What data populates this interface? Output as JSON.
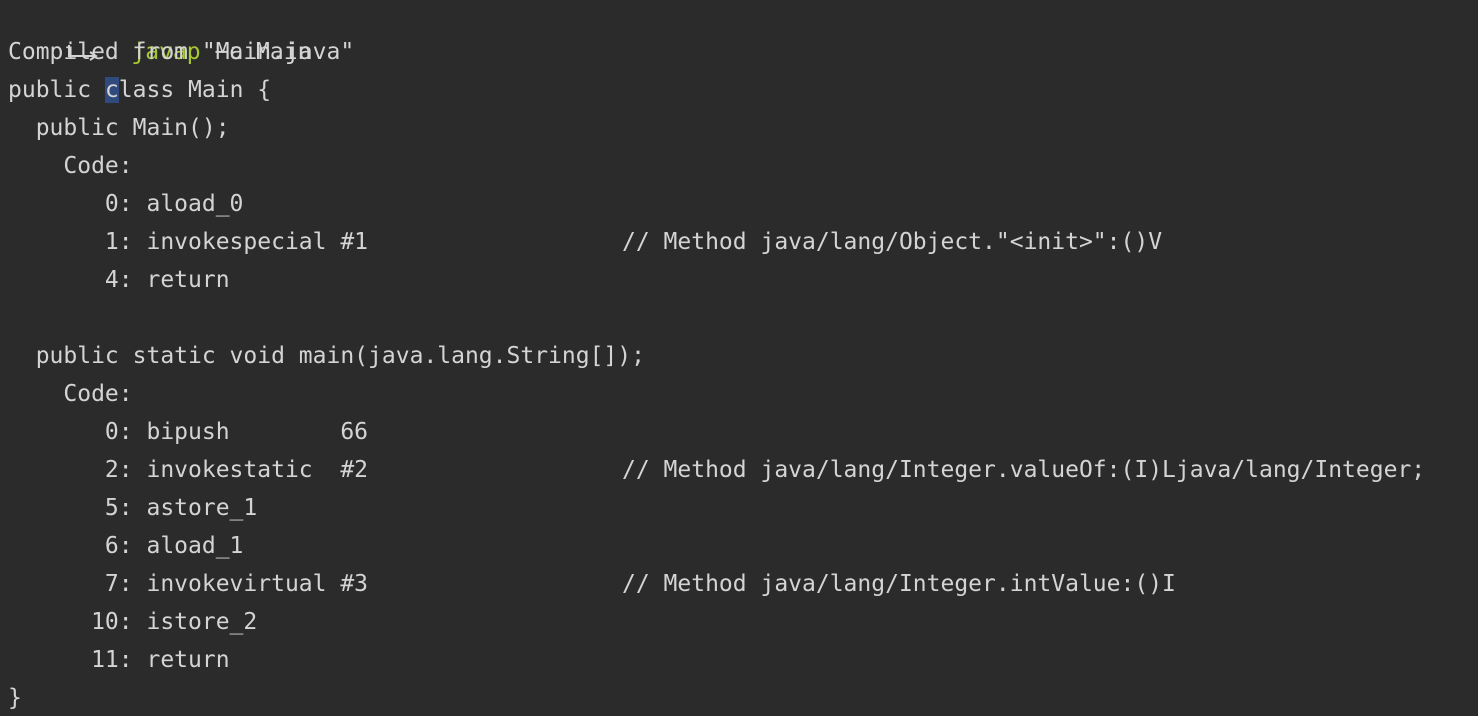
{
  "prompt": {
    "command": "javap",
    "args": " −c Main"
  },
  "output": {
    "compiled_from": "Compiled from \"Main.java\"",
    "class_decl_pre": "public ",
    "class_decl_cursor": "c",
    "class_decl_post": "lass Main {",
    "ctor_sig": "  public Main();",
    "ctor_code_label": "    Code:",
    "ctor_instr_0": "       0: aload_0",
    "ctor_instr_1": "       1: invokespecial #1",
    "ctor_comment_1": "// Method java/lang/Object.\"<init>\":()V",
    "ctor_instr_4": "       4: return",
    "main_sig": "  public static void main(java.lang.String[]);",
    "main_code_label": "    Code:",
    "main_instr_0": "       0: bipush        66",
    "main_instr_2": "       2: invokestatic  #2",
    "main_comment_2": "// Method java/lang/Integer.valueOf:(I)Ljava/lang/Integer;",
    "main_instr_5": "       5: astore_1",
    "main_instr_6": "       6: aload_1",
    "main_instr_7": "       7: invokevirtual #3",
    "main_comment_7": "// Method java/lang/Integer.intValue:()I",
    "main_instr_10": "      10: istore_2",
    "main_instr_11": "      11: return",
    "closing_brace": "}"
  },
  "colors": {
    "background": "#2b2b2b",
    "text": "#d4d4d4",
    "command": "#a6c932",
    "selection": "#2f4a7c"
  }
}
